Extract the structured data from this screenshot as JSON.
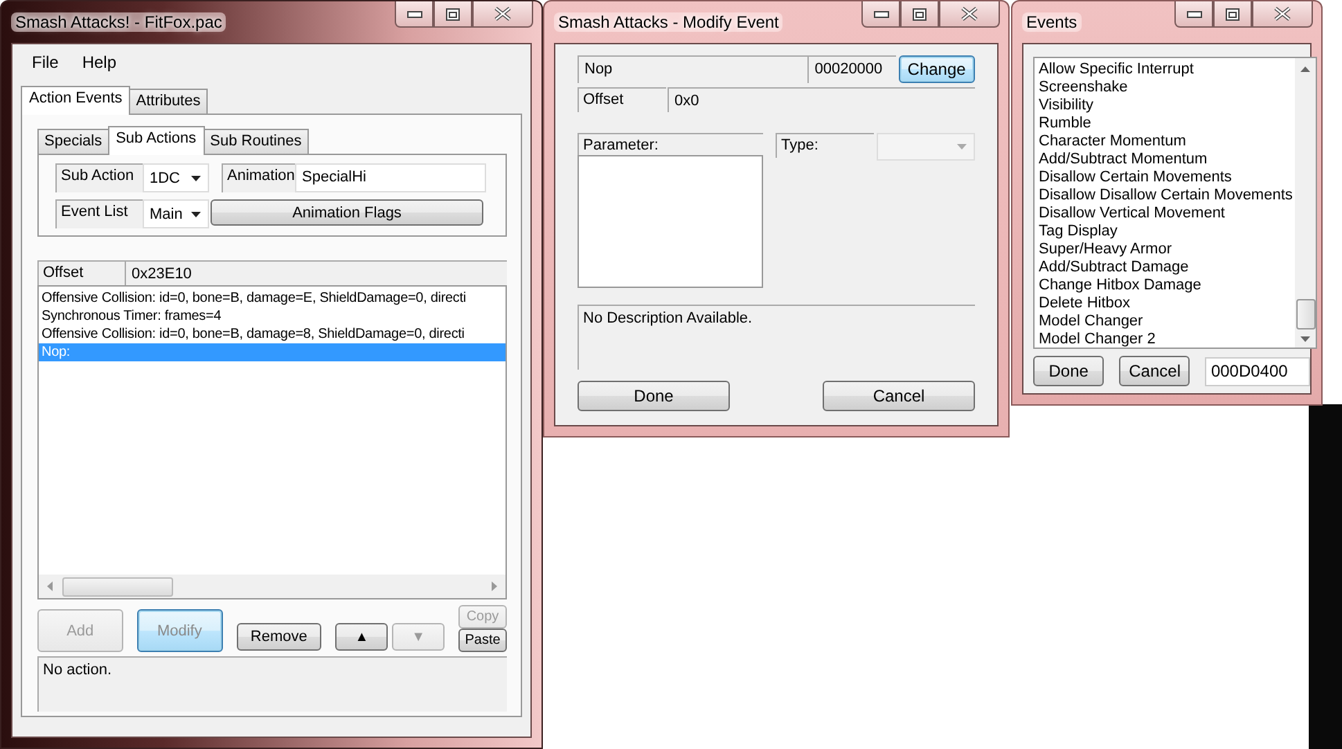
{
  "main_window": {
    "title": "Smash Attacks! - FitFox.pac",
    "menu": [
      "File",
      "Help"
    ],
    "tabs": [
      {
        "label": "Action Events",
        "selected": true
      },
      {
        "label": "Attributes",
        "selected": false
      }
    ],
    "sub_tabs": [
      {
        "label": "Specials",
        "selected": false
      },
      {
        "label": "Sub Actions",
        "selected": true
      },
      {
        "label": "Sub Routines",
        "selected": false
      }
    ],
    "sub_action": {
      "label": "Sub Action",
      "value": "1DC"
    },
    "event_list": {
      "label": "Event List",
      "value": "Main"
    },
    "animation": {
      "label": "Animation",
      "value": "SpecialHi"
    },
    "animation_flags_button": "Animation Flags",
    "offset": {
      "label": "Offset",
      "value": "0x23E10"
    },
    "events": [
      {
        "text": "Offensive Collision: id=0, bone=B, damage=E, ShieldDamage=0, directi",
        "selected": false
      },
      {
        "text": "Synchronous Timer: frames=4",
        "selected": false
      },
      {
        "text": "Offensive Collision: id=0, bone=B, damage=8, ShieldDamage=0, directi",
        "selected": false
      },
      {
        "text": "Nop:",
        "selected": true
      }
    ],
    "buttons": [
      {
        "label": "Add",
        "kind": "large",
        "disabled": true,
        "focused": false
      },
      {
        "label": "Modify",
        "kind": "large",
        "disabled": true,
        "focused": true
      },
      {
        "label": "Remove",
        "kind": "normal",
        "disabled": false,
        "focused": false
      },
      {
        "label": "▲",
        "kind": "arrow",
        "disabled": false,
        "focused": false
      },
      {
        "label": "▼",
        "kind": "arrow",
        "disabled": true,
        "focused": false
      },
      {
        "label": "Copy",
        "kind": "small",
        "disabled": true,
        "focused": false
      },
      {
        "label": "Paste",
        "kind": "small",
        "disabled": false,
        "focused": false
      }
    ],
    "description": "No action."
  },
  "modify_window": {
    "title": "Smash Attacks - Modify Event",
    "event_name": "Nop",
    "event_code": "00020000",
    "change_button": "Change",
    "offset": {
      "label": "Offset",
      "value": "0x0"
    },
    "parameter_header": "Parameter:",
    "type_label": "Type:",
    "description": "No Description Available.",
    "buttons": [
      "Done",
      "Cancel"
    ]
  },
  "events_window": {
    "title": "Events",
    "items": [
      "Allow Specific Interrupt",
      "Screenshake",
      "Visibility",
      "Rumble",
      "Character Momentum",
      "Add/Subtract Momentum",
      "Disallow Certain Movements",
      "Disallow Disallow Certain Movements",
      "Disallow Vertical Movement",
      "Tag Display",
      "Super/Heavy Armor",
      "Add/Subtract Damage",
      "Change Hitbox Damage",
      "Delete Hitbox",
      "Model Changer",
      "Model Changer 2"
    ],
    "buttons": [
      "Done",
      "Cancel"
    ],
    "code_value": "000D0400"
  }
}
